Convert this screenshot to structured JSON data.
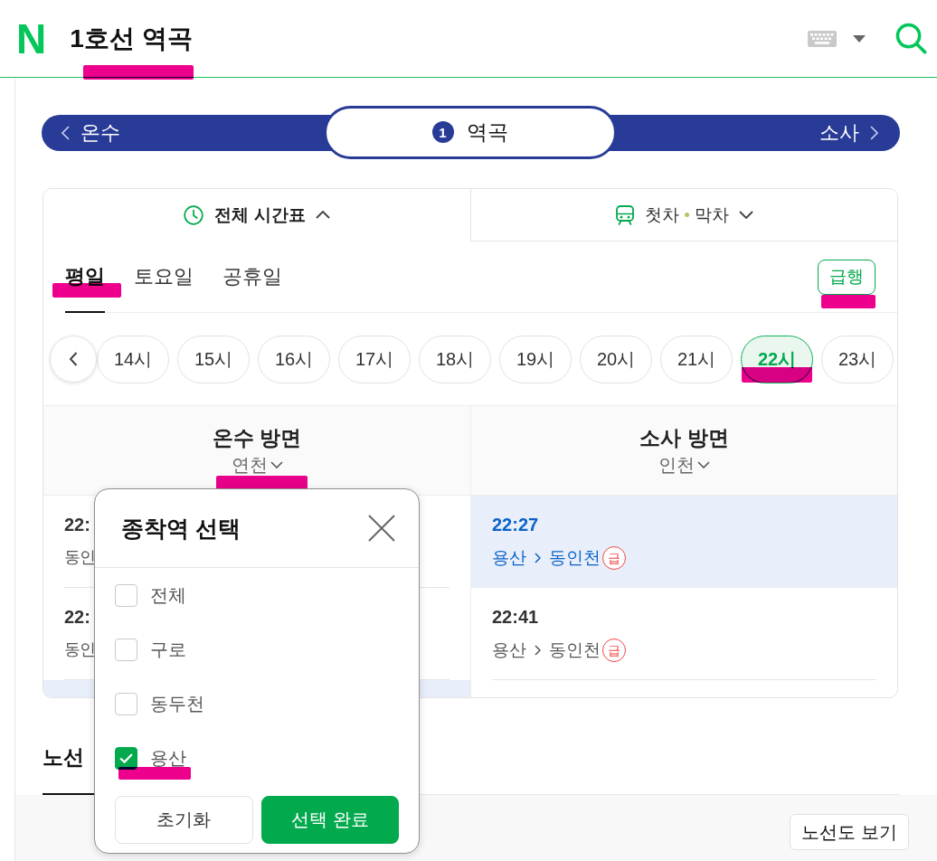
{
  "header": {
    "logo": "N",
    "title": "1호선 역곡",
    "title_marked": true
  },
  "station_bar": {
    "previous": "온수",
    "line_number": "1",
    "current": "역곡",
    "next": "소사"
  },
  "view_tabs": [
    {
      "kind": "timetable",
      "labels": [
        "전체 시간표"
      ],
      "selected": true,
      "expanded": true
    },
    {
      "kind": "first-last",
      "labels": [
        "첫차",
        "막차"
      ],
      "selected": false,
      "expanded": false
    }
  ],
  "day_tabs": [
    {
      "label": "평일",
      "selected": true,
      "marked": true
    },
    {
      "label": "토요일",
      "selected": false,
      "marked": false
    },
    {
      "label": "공휴일",
      "selected": false,
      "marked": false
    }
  ],
  "express_button": {
    "label": "급행",
    "marked": true
  },
  "hours": [
    {
      "label": "14시",
      "selected": false,
      "marked": false
    },
    {
      "label": "15시",
      "selected": false,
      "marked": false
    },
    {
      "label": "16시",
      "selected": false,
      "marked": false
    },
    {
      "label": "17시",
      "selected": false,
      "marked": false
    },
    {
      "label": "18시",
      "selected": false,
      "marked": false
    },
    {
      "label": "19시",
      "selected": false,
      "marked": false
    },
    {
      "label": "20시",
      "selected": false,
      "marked": false
    },
    {
      "label": "21시",
      "selected": false,
      "marked": false
    },
    {
      "label": "22시",
      "selected": true,
      "marked": true
    },
    {
      "label": "23시",
      "selected": false,
      "marked": false
    }
  ],
  "directions": [
    {
      "name": "온수 방면",
      "destination": "연천",
      "destination_marked": true,
      "rows": [
        {
          "time": "22:",
          "route": "동인",
          "selected": false
        },
        {
          "time": "22:",
          "route": "동인",
          "selected": false
        },
        {
          "selected": true
        }
      ]
    },
    {
      "name": "소사 방면",
      "destination": "인천",
      "destination_marked": false,
      "rows": [
        {
          "time": "22:27",
          "origin": "용산",
          "terminus": "동인천",
          "badge": "급",
          "selected": true
        },
        {
          "time": "22:41",
          "origin": "용산",
          "terminus": "동인천",
          "badge": "급",
          "selected": false
        }
      ]
    }
  ],
  "bottom_tab": {
    "label": "노선",
    "selected": true
  },
  "route_map_button": "노선도 보기",
  "popup": {
    "title": "종착역 선택",
    "options": [
      {
        "label": "전체",
        "checked": false,
        "marked": false
      },
      {
        "label": "구로",
        "checked": false,
        "marked": false
      },
      {
        "label": "동두천",
        "checked": false,
        "marked": false
      },
      {
        "label": "용산",
        "checked": true,
        "marked": true
      }
    ],
    "buttons": [
      {
        "label": "초기화",
        "kind": "secondary"
      },
      {
        "label": "선택 완료",
        "kind": "primary"
      }
    ]
  }
}
